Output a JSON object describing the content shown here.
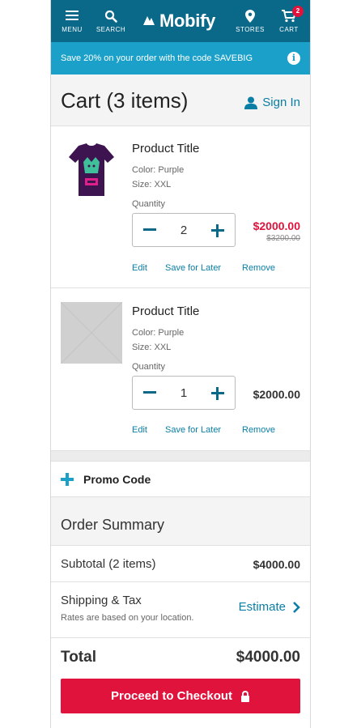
{
  "header": {
    "menu_label": "MENU",
    "search_label": "SEARCH",
    "logo_text": "Mobify",
    "stores_label": "STORES",
    "cart_label": "CART",
    "cart_count": "2",
    "bg_color": "#0a6889"
  },
  "banner": {
    "text": "Save 20% on your order with the code SAVEBIG",
    "info_icon": "i",
    "bg_color": "#1ba1c9"
  },
  "cart": {
    "title": "Cart (3 items)",
    "sign_in_label": "Sign In",
    "items": [
      {
        "title": "Product Title",
        "color": "Color: Purple",
        "size": "Size: XXL",
        "quantity_label": "Quantity",
        "quantity": "2",
        "price": "$2000.00",
        "original_price": "$3200.00",
        "price_color": "#e0133c",
        "image": "purple-tshirt",
        "actions": {
          "edit": "Edit",
          "save_for_later": "Save for Later",
          "remove": "Remove"
        }
      },
      {
        "title": "Product Title",
        "color": "Color: Purple",
        "size": "Size: XXL",
        "quantity_label": "Quantity",
        "quantity": "1",
        "price": "$2000.00",
        "image": "placeholder-image",
        "actions": {
          "edit": "Edit",
          "save_for_later": "Save for Later",
          "remove": "Remove"
        }
      }
    ]
  },
  "promo": {
    "label": "Promo Code"
  },
  "summary": {
    "title": "Order Summary",
    "subtotal_label": "Subtotal (2 items)",
    "subtotal_value": "$4000.00",
    "shipping_label": "Shipping & Tax",
    "shipping_note": "Rates are based on your location.",
    "estimate_label": "Estimate",
    "total_label": "Total",
    "total_value": "$4000.00",
    "checkout_label": "Proceed to Checkout",
    "checkout_color": "#e0133c"
  }
}
